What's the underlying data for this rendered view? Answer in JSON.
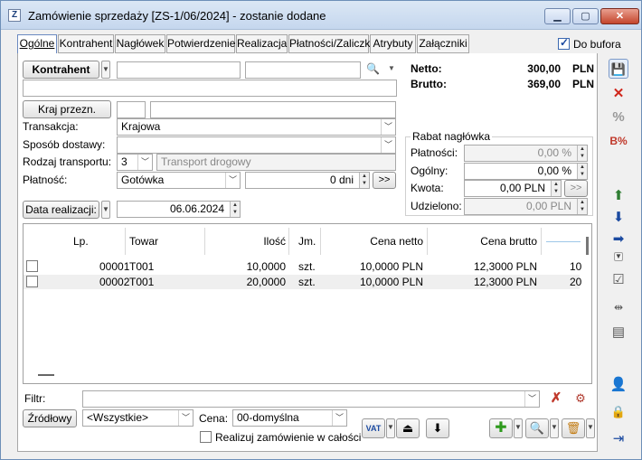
{
  "window": {
    "app_icon_glyph": "Z",
    "title": "Zamówienie sprzedaży [ZS-1/06/2024] - zostanie dodane",
    "minimize_glyph": "▁",
    "maximize_glyph": "▢",
    "close_glyph": "✕"
  },
  "tabs": [
    {
      "label": "Ogólne",
      "active": true
    },
    {
      "label": "Kontrahent"
    },
    {
      "label": "Nagłówek"
    },
    {
      "label": "Potwierdzenie"
    },
    {
      "label": "Realizacja"
    },
    {
      "label": "Płatności/Zaliczki"
    },
    {
      "label": "Atrybuty"
    },
    {
      "label": "Załączniki"
    }
  ],
  "do_bufora": {
    "label": "Do bufora",
    "checked": true
  },
  "kontrahent": {
    "button_label": "Kontrahent",
    "code": "",
    "name": "",
    "address": "",
    "search_glyph": "🔍"
  },
  "kraj": {
    "button_label": "Kraj przezn.",
    "code": "",
    "name": ""
  },
  "form": {
    "transakcja_label": "Transakcja:",
    "transakcja_value": "Krajowa",
    "sposob_label": "Sposób dostawy:",
    "sposob_value": "",
    "rodzaj_label": "Rodzaj transportu:",
    "rodzaj_code": "3",
    "rodzaj_placeholder": "Transport drogowy",
    "platnosc_label": "Płatność:",
    "platnosc_value": "Gotówka",
    "platnosc_days": "0 dni",
    "platnosc_more": ">>",
    "data_button": "Data realizacji:",
    "data_value": "06.06.2024"
  },
  "totals": {
    "netto_label": "Netto:",
    "netto_value": "300,00",
    "netto_currency": "PLN",
    "brutto_label": "Brutto:",
    "brutto_value": "369,00",
    "brutto_currency": "PLN"
  },
  "rabat": {
    "group_label": "Rabat nagłówka",
    "platnosci_label": "Płatności:",
    "platnosci_value": "0,00 %",
    "ogolny_label": "Ogólny:",
    "ogolny_value": "0,00 %",
    "kwota_label": "Kwota:",
    "kwota_value": "0,00 PLN",
    "kwota_more": ">>",
    "udzielono_label": "Udzielono:",
    "udzielono_value": "0,00 PLN"
  },
  "grid": {
    "headers": {
      "lp": "Lp.",
      "towar": "Towar",
      "ilosc": "Ilość",
      "jm": "Jm.",
      "netto": "Cena netto",
      "brutto": "Cena brutto"
    },
    "rows": [
      {
        "lp": "00001",
        "towar": "T001",
        "ilosc": "10,0000",
        "jm": "szt.",
        "netto": "10,0000 PLN",
        "brutto": "12,3000 PLN",
        "extra": "10"
      },
      {
        "lp": "00002",
        "towar": "T001",
        "ilosc": "20,0000",
        "jm": "szt.",
        "netto": "10,0000 PLN",
        "brutto": "12,3000 PLN",
        "extra": "20"
      }
    ]
  },
  "filter": {
    "label": "Filtr:",
    "value": ""
  },
  "bottom": {
    "zrodlowy_button": "Źródłowy",
    "zrodlowy_value": "<Wszystkie>",
    "cena_label": "Cena:",
    "cena_value": "00-domyślna",
    "realizuj_label": "Realizuj zamówienie w całości",
    "realizuj_checked": false,
    "vat_label": "VAT"
  },
  "icons": {
    "save": "💾",
    "cancel": "✕",
    "percent": "%",
    "bs": "B%",
    "add": "✚",
    "search": "🔍",
    "trash": "🗑",
    "lock": "🔒"
  }
}
